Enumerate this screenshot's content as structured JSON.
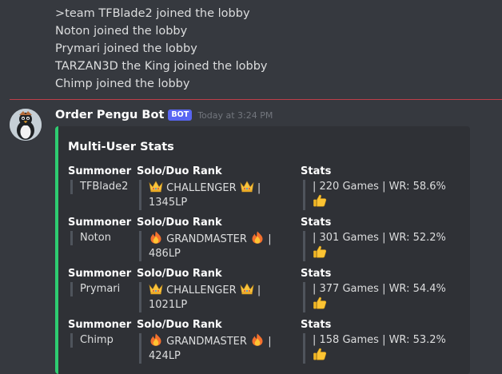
{
  "lobby_lines": [
    ">team TFBlade2 joined the lobby",
    "Noton joined the lobby",
    "Prymari joined the lobby",
    "TARZAN3D the King joined the lobby",
    "Chimp joined the lobby"
  ],
  "message": {
    "author": "Order Pengu Bot",
    "bot_tag": "BOT",
    "timestamp": "Today at 3:24 PM",
    "avatar_icon": "penguin-avatar",
    "embed": {
      "accent_color": "#2ecc71",
      "title": "Multi-User Stats",
      "field_names": {
        "summoner": "Summoner",
        "rank": "Solo/Duo Rank",
        "stats": "Stats"
      },
      "rows": [
        {
          "summoner": "TFBlade2",
          "rank_icon": "crown",
          "rank": "CHALLENGER",
          "rank_sep": "|",
          "lp": "1345LP",
          "stats": "| 220 Games | WR: 58.6%",
          "stats_icon": "thumbs-up"
        },
        {
          "summoner": "Noton",
          "rank_icon": "fire",
          "rank": "GRANDMASTER",
          "rank_sep": "|",
          "lp": "486LP",
          "stats": "| 301 Games | WR: 52.2%",
          "stats_icon": "thumbs-up"
        },
        {
          "summoner": "Prymari",
          "rank_icon": "crown",
          "rank": "CHALLENGER",
          "rank_sep": "|",
          "lp": "1021LP",
          "stats": "| 377 Games | WR: 54.4%",
          "stats_icon": "thumbs-up"
        },
        {
          "summoner": "Chimp",
          "rank_icon": "fire",
          "rank": "GRANDMASTER",
          "rank_sep": "|",
          "lp": "424LP",
          "stats": "| 158 Games | WR: 53.2%",
          "stats_icon": "thumbs-up"
        }
      ]
    }
  },
  "colors": {
    "background": "#36393f",
    "embed_bg": "#2f3136",
    "divider": "#d6404b",
    "bot_tag": "#5865f2"
  }
}
